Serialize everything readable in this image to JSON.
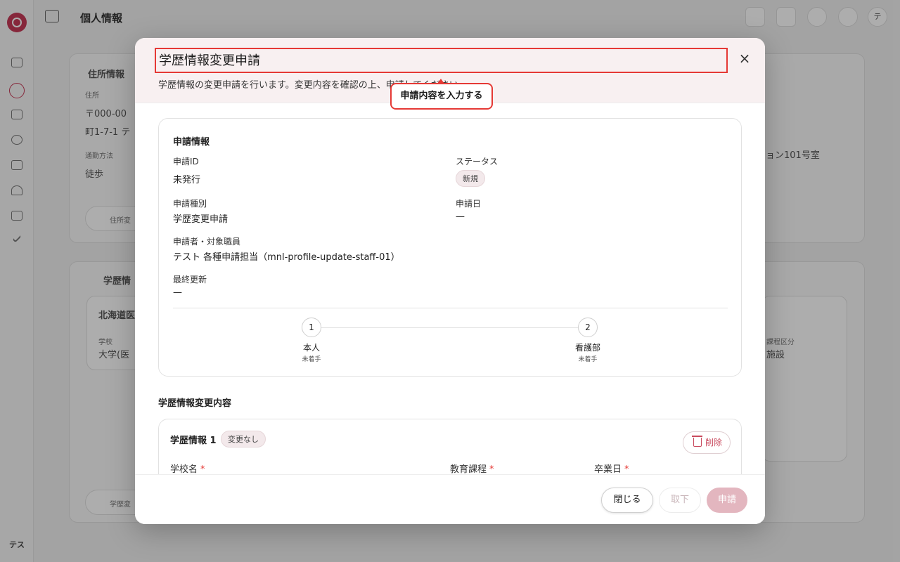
{
  "background": {
    "page_title": "個人情報",
    "sidebar_avatar": "テス",
    "user_avatar": "テ",
    "address_section": "住所情報",
    "address_label": "住所",
    "postal": "〒000-00",
    "address_line": "町1-7-1 テ",
    "commute_label": "通勤方法",
    "commute_value": "徒歩",
    "address_button": "住所変",
    "right_address": "ョン101号室",
    "education_section": "学歴情",
    "edu_school_short": "北海道医",
    "edu_type_label": "学校",
    "edu_type_value": "大学(医",
    "edu_right_label": "課程区分",
    "edu_right_value": "施設",
    "edu_button": "学歴変"
  },
  "modal": {
    "title": "学歴情報変更申請",
    "description": "学歴情報の変更申請を行います。変更内容を確認の上、申請してください。",
    "tooltip": "申請内容を入力する",
    "close_icon": "×",
    "info": {
      "section_title": "申請情報",
      "id_label": "申請ID",
      "id_value": "未発行",
      "status_label": "ステータス",
      "status_value": "新規",
      "type_label": "申請種別",
      "type_value": "学歴変更申請",
      "date_label": "申請日",
      "date_value": "—",
      "applicant_label": "申請者・対象職員",
      "applicant_value": "テスト 各種申請担当（mnl-profile-update-staff-01）",
      "updated_label": "最終更新",
      "updated_value": "—"
    },
    "steps": [
      {
        "number": "1",
        "name": "本人",
        "status": "未着手"
      },
      {
        "number": "2",
        "name": "看護部",
        "status": "未着手"
      }
    ],
    "changes": {
      "section_title": "学歴情報変更内容",
      "card_title": "学歴情報 1",
      "card_badge": "変更なし",
      "delete_label": "削除",
      "field_school": "学校名",
      "field_course": "教育課程",
      "field_graduation": "卒業日",
      "required_mark": "*"
    },
    "footer": {
      "close_label": "閉じる",
      "withdraw_label": "取下",
      "submit_label": "申請"
    }
  },
  "colors": {
    "accent": "#e53935",
    "brand": "#c63a57",
    "submit_disabled": "#e3b6bf",
    "header_tint": "#f8f0f1"
  }
}
